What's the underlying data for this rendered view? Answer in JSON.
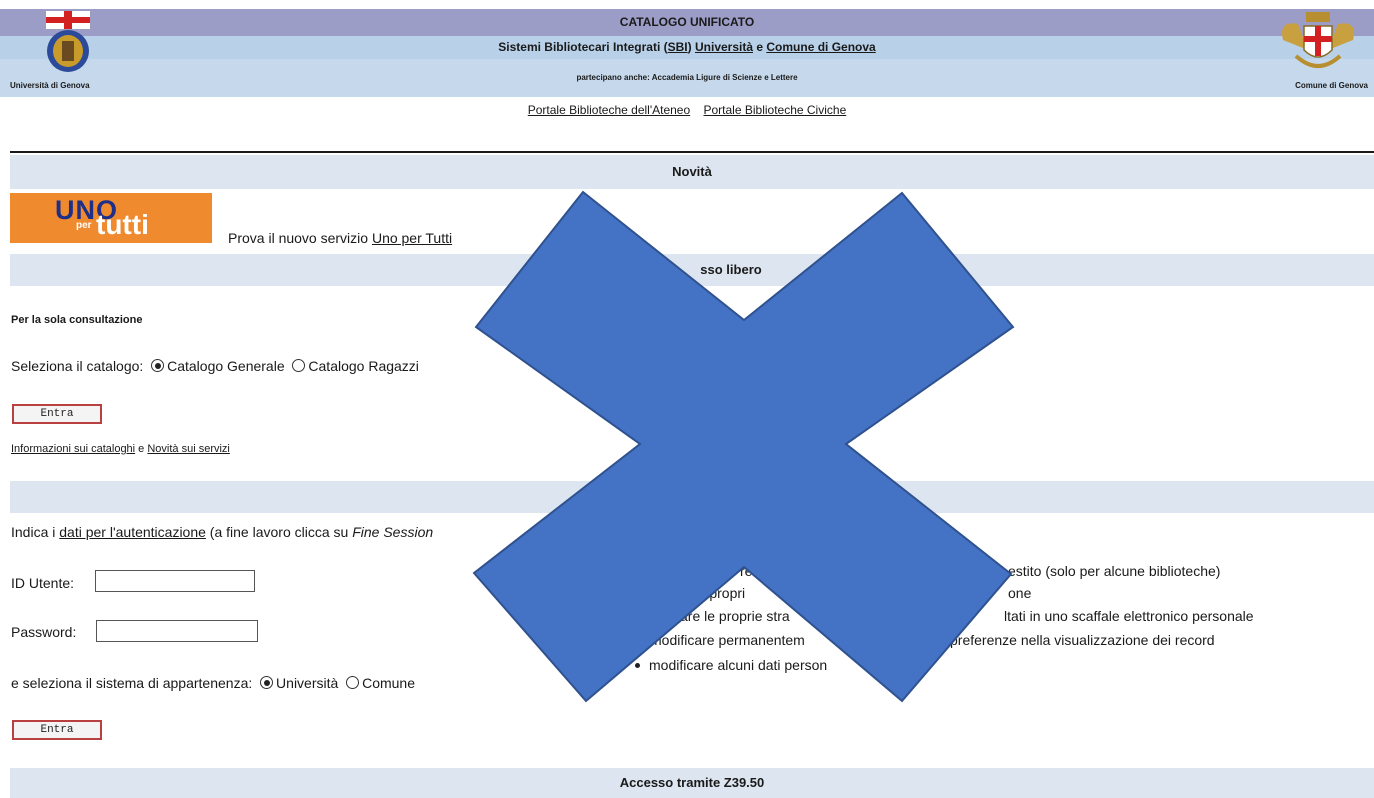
{
  "header": {
    "title": "CATALOGO UNIFICATO",
    "subtitle_parts": [
      "Sistemi Bibliotecari Integrati (",
      "SBI",
      ") ",
      "Università",
      " e ",
      "Comune di Genova"
    ],
    "participants": "partecipano anche: Accademia Ligure di Scienze e Lettere",
    "left_caption": "Università di Genova",
    "right_caption": "Comune di Genova"
  },
  "portals": [
    "Portale Biblioteche dell'Ateneo",
    "Portale Biblioteche Civiche"
  ],
  "novita": {
    "heading": "Novità",
    "banner": {
      "word1": "UNO",
      "word2": "per",
      "word3": "tutti"
    },
    "prompt": "Prova il nuovo servizio ",
    "link": "Uno per Tutti"
  },
  "free_access": {
    "heading": "sso libero",
    "subheading": "Per la sola consultazione",
    "select_label": "Seleziona il catalogo:",
    "options": [
      "Catalogo Generale",
      "Catalogo Ragazzi"
    ],
    "selected": "Catalogo Generale",
    "button": "Entra",
    "info_link": "Informazioni sui cataloghi",
    "info_and": " e ",
    "news_link": "Novità sui servizi"
  },
  "auth": {
    "intro_prefix": "Indica i ",
    "intro_link": "dati per l'autenticazione",
    "intro_suffix": " (a fine lavoro clicca su ",
    "intro_italic": "Fine Session",
    "user_label": "ID Utente:",
    "user_value": "",
    "password_label": "Password:",
    "password_value": "",
    "system_label": "e seleziona il sistema di appartenenza:",
    "systems": [
      "Università",
      "Comune"
    ],
    "selected_system": "Università",
    "button": "Entra",
    "features": [
      {
        "text_a": "re",
        "text_b": "estito (solo per alcune biblioteche)"
      },
      {
        "text_a": "re i propri",
        "text_b": "one"
      },
      {
        "text_a": "are le proprie stra",
        "text_b": "ltati in uno scaffale elettronico personale"
      },
      {
        "text_a": "modificare permanentem",
        "text_b": "preferenze nella visualizzazione dei record"
      },
      {
        "text_a": "modificare alcuni dati person",
        "text_b": ""
      }
    ]
  },
  "z3950": {
    "heading": "Accesso tramite Z39.50"
  },
  "overlay": {
    "color": "#4472c4",
    "outline": "#2f528f"
  }
}
